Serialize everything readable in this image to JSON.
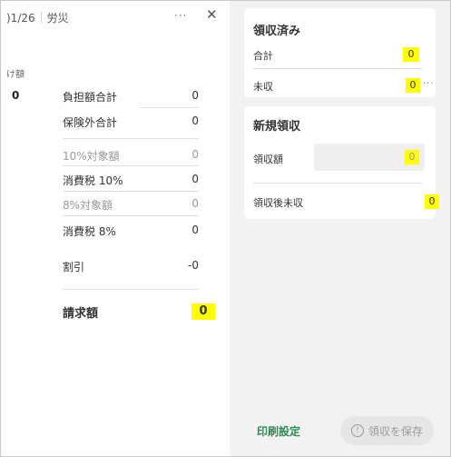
{
  "header": {
    "date_fragment": ")1/26",
    "insurance_type": "労災",
    "more_label": "···",
    "close_label": "✕"
  },
  "side": {
    "label": "け額",
    "value": "0"
  },
  "billing": {
    "rows": [
      {
        "label": "負担額合計",
        "value": "0"
      },
      {
        "label": "保険外合計",
        "value": "0"
      },
      {
        "label": "10%対象額",
        "value": "0"
      },
      {
        "label": "消費税 10%",
        "value": "0"
      },
      {
        "label": "8%対象額",
        "value": "0"
      },
      {
        "label": "消費税 8%",
        "value": "0"
      },
      {
        "label": "割引",
        "value": "-0"
      }
    ],
    "total_label": "請求額",
    "total_value": "0"
  },
  "received": {
    "title": "領収済み",
    "total_label": "合計",
    "total_value": "0",
    "unpaid_label": "未収",
    "unpaid_value": "0",
    "more_label": "···"
  },
  "new_receipt": {
    "title": "新規領収",
    "amount_label": "領収額",
    "amount_value": "0",
    "after_unpaid_label": "領収後未収",
    "after_unpaid_value": "0"
  },
  "footer": {
    "print_settings_label": "印刷設定",
    "save_receipt_label": "領収を保存",
    "save_icon": "clock-icon"
  },
  "colors": {
    "highlight": "#ffff00",
    "accent_green": "#2e8b57",
    "panel_gray": "#f2f2f2"
  }
}
